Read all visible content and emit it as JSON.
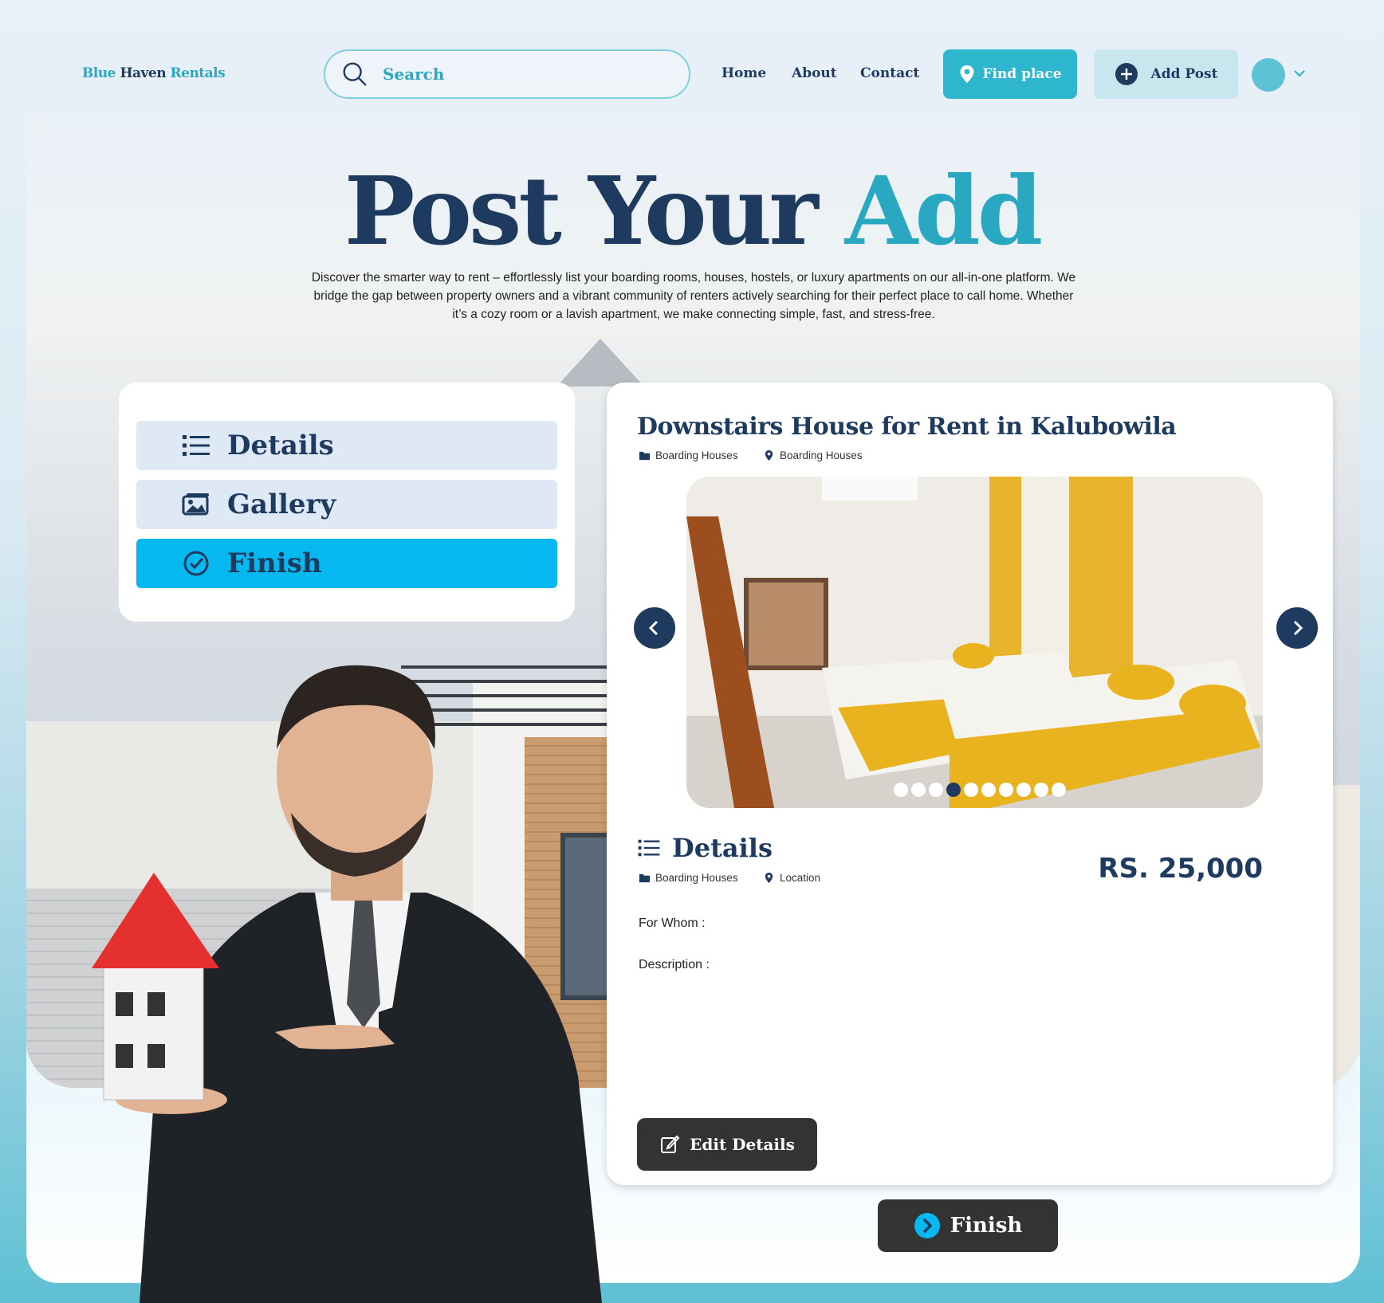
{
  "header": {
    "brand": {
      "part1": "Blue",
      "part2": "Haven",
      "part3": "Rentals"
    },
    "search_placeholder": "Search",
    "nav": [
      "Home",
      "About",
      "Contact"
    ],
    "find_label": "Find place",
    "add_label": "Add Post"
  },
  "hero": {
    "title_main": "Post Your",
    "title_accent": "Add",
    "description": "Discover the smarter way to rent – effortlessly list your boarding rooms, houses, hostels, or luxury apartments on our all-in-one platform. We bridge the gap between property owners and a vibrant community of renters actively searching for their perfect place to call home. Whether it’s a cozy room or a lavish apartment, we make connecting simple, fast, and stress-free."
  },
  "tabs": [
    {
      "label": "Details",
      "icon": "list-icon",
      "active": false
    },
    {
      "label": "Gallery",
      "icon": "gallery-icon",
      "active": false
    },
    {
      "label": "Finish",
      "icon": "check-circle-icon",
      "active": true
    }
  ],
  "listing": {
    "title": "Downstairs House for Rent in Kalubowila",
    "category": "Boarding Houses",
    "location": "Boarding Houses",
    "gallery_dots": 10,
    "gallery_active_index": 3,
    "details_heading": "Details",
    "details_category": "Boarding Houses",
    "details_location": "Location",
    "price": "RS. 25,000",
    "for_whom_label": "For Whom :",
    "description_label": "Description :",
    "edit_label": "Edit Details"
  },
  "finish_label": "Finish",
  "colors": {
    "navy": "#1e3a5f",
    "teal": "#2aa8c2",
    "cyan": "#06b8f0",
    "dark_button": "#333333"
  }
}
